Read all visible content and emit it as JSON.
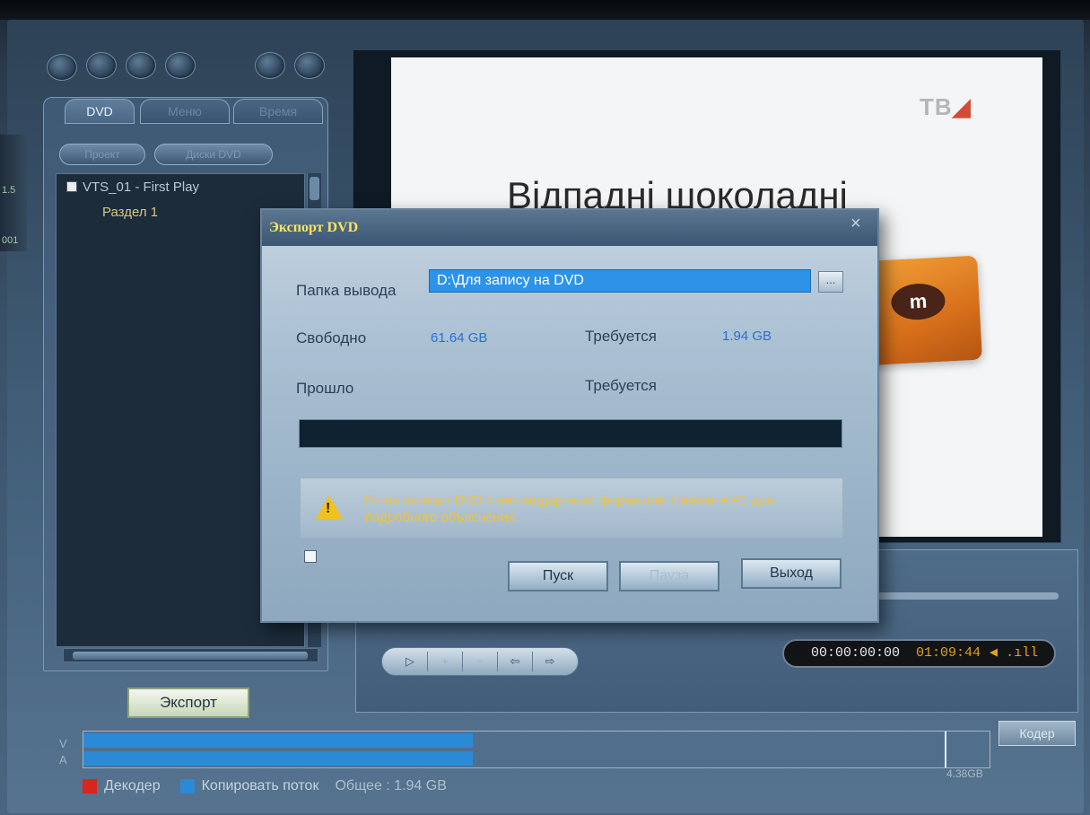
{
  "left_panel": {
    "tabs": [
      {
        "label": "DVD"
      },
      {
        "label": "Меню"
      },
      {
        "label": "Время"
      }
    ],
    "buttons": [
      {
        "label": "Проект"
      },
      {
        "label": "Диски DVD"
      }
    ],
    "tree": {
      "items": [
        {
          "label": "VTS_01 - First Play"
        },
        {
          "label": "Раздел 1"
        }
      ]
    },
    "export_label": "Экспорт"
  },
  "preview": {
    "logo": "ТВ",
    "headline": "Відпадні шоколадні",
    "candy": "m"
  },
  "player": {
    "transport": [
      "▷",
      "+",
      "−",
      "⇦",
      "⇨"
    ],
    "timecode": "00:00:00:00",
    "duration": "01:09:44",
    "volume": "◀ .ıll"
  },
  "bottom": {
    "v_label": "V",
    "a_label": "A",
    "coder_label": "Кодер",
    "capacity_total": "4.38GB",
    "video_fill_percent": 43,
    "audio_fill_percent": 43,
    "mark_percent": 95,
    "legend": {
      "decoder": "Декодер",
      "copy_stream": "Копировать поток",
      "total": "Общее : 1.94 GB"
    },
    "colors": {
      "decoder": "#d9261c",
      "copy_stream": "#2b8ad6"
    }
  },
  "dialog": {
    "title": "Экспорт DVD",
    "close": "×",
    "output_folder_label": "Папка вывода",
    "output_folder_value": "D:\\Для запису на DVD",
    "browse_label": "...",
    "free_label": "Свободно",
    "free_value": "61.64 GB",
    "required_label": "Требуется",
    "required_value": "1.94 GB",
    "elapsed_label": "Прошло",
    "remaining_label": "Требуется",
    "progress_percent": 0,
    "warning": "Готов экспорт DVD с нестандартным форматом. Нажмите F1 для подробного объяснения.",
    "buttons": {
      "start": "Пуск",
      "pause": "Пауза",
      "exit": "Выход"
    }
  },
  "edge": {
    "a": "1.5",
    "b": "001"
  }
}
